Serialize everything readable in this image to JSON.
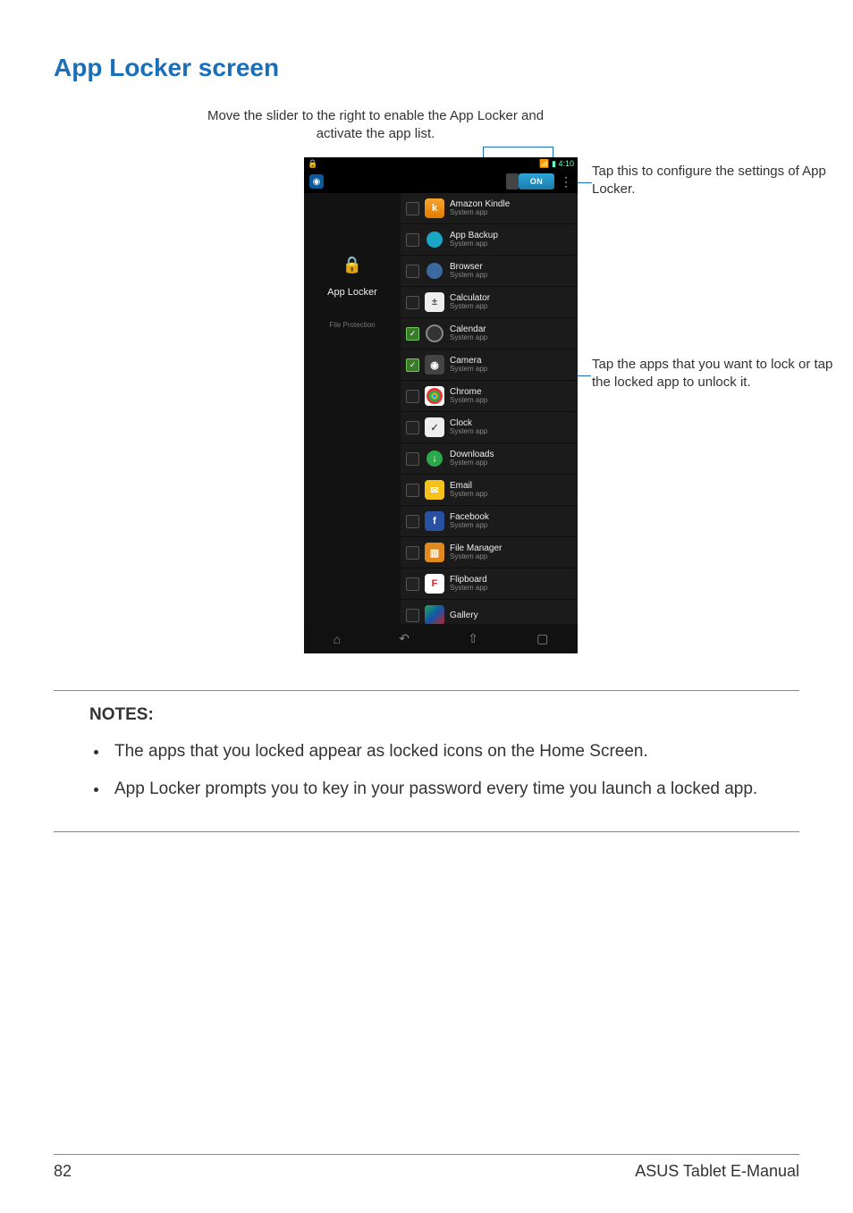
{
  "title": "App Locker screen",
  "caption_top": "Move the slider to the right to enable the App Locker and activate the app list.",
  "callout_settings": "Tap this to configure the settings of App Locker.",
  "callout_apps": "Tap the apps that you want to lock or tap the locked app to unlock it.",
  "phone": {
    "status_time": "4:10",
    "toggle": "ON",
    "sidebar": {
      "tab1": "App Locker",
      "tab2": "File Protection"
    },
    "sub": "System app",
    "apps": {
      "a0": "Amazon Kindle",
      "a1": "App Backup",
      "a2": "Browser",
      "a3": "Calculator",
      "a4": "Calendar",
      "a5": "Camera",
      "a6": "Chrome",
      "a7": "Clock",
      "a8": "Downloads",
      "a9": "Email",
      "a10": "Facebook",
      "a11": "File Manager",
      "a12": "Flipboard",
      "a13": "Gallery"
    }
  },
  "notes": {
    "heading": "NOTES:",
    "n1": "The apps that you locked appear as locked icons on the Home Screen.",
    "n2": "App Locker prompts you to key in your password every time you launch a locked app."
  },
  "footer": {
    "page": "82",
    "manual": "ASUS Tablet E-Manual"
  }
}
